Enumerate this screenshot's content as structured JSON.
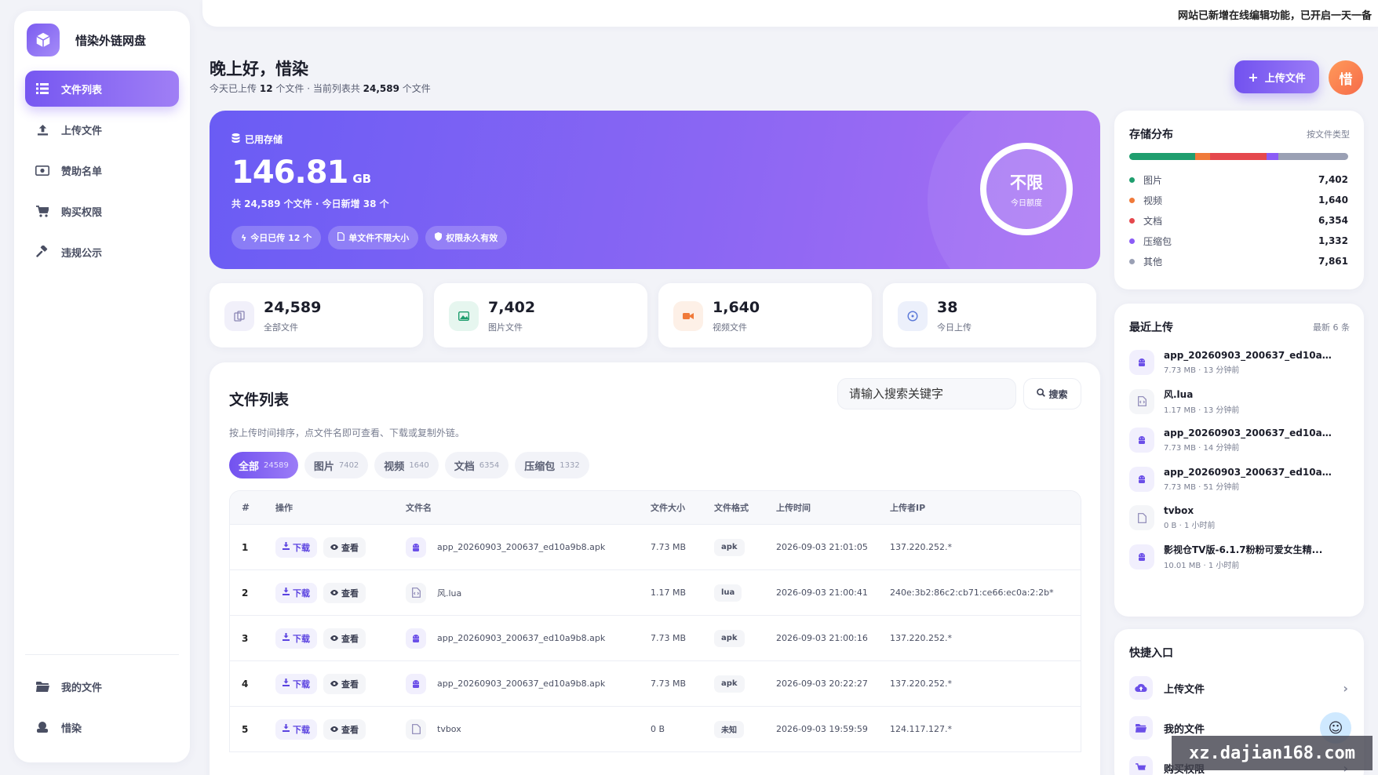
{
  "app": {
    "name": "惜染外链网盘"
  },
  "notice": "网站已新增在线编辑功能，已开启一天一备",
  "nav": {
    "items": [
      {
        "label": "文件列表",
        "icon": "list-icon"
      },
      {
        "label": "上传文件",
        "icon": "upload-icon"
      },
      {
        "label": "赞助名单",
        "icon": "money-icon"
      },
      {
        "label": "购买权限",
        "icon": "cart-icon"
      },
      {
        "label": "违规公示",
        "icon": "gavel-icon"
      }
    ],
    "bottom": [
      {
        "label": "我的文件",
        "icon": "folder-icon"
      },
      {
        "label": "惜染",
        "icon": "user-icon"
      }
    ]
  },
  "header": {
    "greeting": "晚上好，惜染",
    "sub_prefix": "今天已上传",
    "today_count": "12",
    "sub_mid": "个文件 · 当前列表共",
    "total_count": "24,589",
    "sub_suffix": "个文件",
    "upload_label": "上传文件",
    "avatar_text": "惜"
  },
  "hero": {
    "label": "已用存储",
    "value": "146.81",
    "unit": "GB",
    "sub": "共 24,589 个文件 · 今日新增 38 个",
    "chips": [
      "今日已传 12 个",
      "单文件不限大小",
      "权限永久有效"
    ],
    "ring_main": "不限",
    "ring_sub": "今日额度"
  },
  "stats": [
    {
      "value": "24,589",
      "label": "全部文件",
      "icon": "files-icon",
      "color": "#8b86b5",
      "bg": "#f1f0fa"
    },
    {
      "value": "7,402",
      "label": "图片文件",
      "icon": "image-icon",
      "color": "#1f9e6e",
      "bg": "#e6f6ef"
    },
    {
      "value": "1,640",
      "label": "视频文件",
      "icon": "video-icon",
      "color": "#f07a3a",
      "bg": "#fdf0e7"
    },
    {
      "value": "38",
      "label": "今日上传",
      "icon": "clock-icon",
      "color": "#5a78d8",
      "bg": "#ecf0fb"
    }
  ],
  "main": {
    "title": "文件列表",
    "search_placeholder": "请输入搜索关键字",
    "search_label": "搜索",
    "hint": "按上传时间排序，点文件名即可查看、下载或复制外链。",
    "tabs": [
      {
        "label": "全部",
        "count": "24589"
      },
      {
        "label": "图片",
        "count": "7402"
      },
      {
        "label": "视频",
        "count": "1640"
      },
      {
        "label": "文档",
        "count": "6354"
      },
      {
        "label": "压缩包",
        "count": "1332"
      }
    ],
    "columns": [
      "#",
      "操作",
      "文件名",
      "文件大小",
      "文件格式",
      "上传时间",
      "上传者IP"
    ],
    "download_label": "下载",
    "view_label": "查看",
    "rows": [
      {
        "n": "1",
        "name": "app_20260903_200637_ed10a9b8.apk",
        "size": "7.73 MB",
        "ext": "apk",
        "time": "2026-09-03 21:01:05",
        "ip": "137.220.252.*",
        "kind": "android"
      },
      {
        "n": "2",
        "name": "风.lua",
        "size": "1.17 MB",
        "ext": "lua",
        "time": "2026-09-03 21:00:41",
        "ip": "240e:3b2:86c2:cb71:ce66:ec0a:2:2b*",
        "kind": "code"
      },
      {
        "n": "3",
        "name": "app_20260903_200637_ed10a9b8.apk",
        "size": "7.73 MB",
        "ext": "apk",
        "time": "2026-09-03 21:00:16",
        "ip": "137.220.252.*",
        "kind": "android"
      },
      {
        "n": "4",
        "name": "app_20260903_200637_ed10a9b8.apk",
        "size": "7.73 MB",
        "ext": "apk",
        "time": "2026-09-03 20:22:27",
        "ip": "137.220.252.*",
        "kind": "android"
      },
      {
        "n": "5",
        "name": "tvbox",
        "size": "0 B",
        "ext": "未知",
        "time": "2026-09-03 19:59:59",
        "ip": "124.117.127.*",
        "kind": "file"
      }
    ]
  },
  "storage": {
    "title": "存储分布",
    "meta": "按文件类型",
    "items": [
      {
        "label": "图片",
        "value": "7,402",
        "color": "#1f9e6e",
        "share": 30.1
      },
      {
        "label": "视频",
        "value": "1,640",
        "color": "#f07a3a",
        "share": 6.7
      },
      {
        "label": "文档",
        "value": "6,354",
        "color": "#e5484d",
        "share": 25.8
      },
      {
        "label": "压缩包",
        "value": "1,332",
        "color": "#8b5cf6",
        "share": 5.4
      },
      {
        "label": "其他",
        "value": "7,861",
        "color": "#9aa0b4",
        "share": 32.0
      }
    ]
  },
  "recent": {
    "title": "最近上传",
    "meta": "最新 6 条",
    "items": [
      {
        "name": "app_20260903_200637_ed10a9b8...",
        "meta": "7.73 MB · 13 分钟前",
        "kind": "android"
      },
      {
        "name": "风.lua",
        "meta": "1.17 MB · 13 分钟前",
        "kind": "code"
      },
      {
        "name": "app_20260903_200637_ed10a9b8...",
        "meta": "7.73 MB · 14 分钟前",
        "kind": "android"
      },
      {
        "name": "app_20260903_200637_ed10a9b8...",
        "meta": "7.73 MB · 51 分钟前",
        "kind": "android"
      },
      {
        "name": "tvbox",
        "meta": "0 B · 1 小时前",
        "kind": "file"
      },
      {
        "name": "影视仓TV版-6.1.7粉粉可爱女生精...",
        "meta": "10.01 MB · 1 小时前",
        "kind": "android"
      }
    ]
  },
  "quick": {
    "title": "快捷入口",
    "items": [
      {
        "label": "上传文件",
        "icon": "cloud-upload-icon"
      },
      {
        "label": "我的文件",
        "icon": "folder-icon"
      },
      {
        "label": "购买权限",
        "icon": "cart-icon"
      }
    ]
  },
  "watermark": "xz.dajian168.com"
}
